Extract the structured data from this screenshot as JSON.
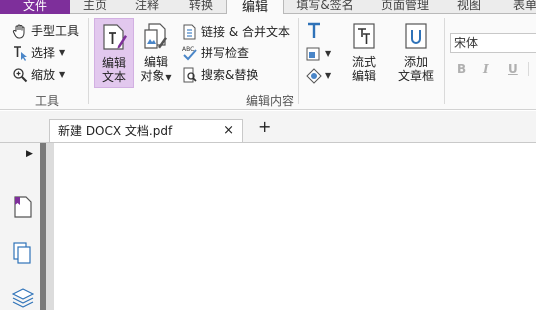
{
  "menu": {
    "tabs": [
      {
        "label": "文件"
      },
      {
        "label": "主页"
      },
      {
        "label": "注释"
      },
      {
        "label": "转换"
      },
      {
        "label": "编辑"
      },
      {
        "label": "填写&签名"
      },
      {
        "label": "页面管理"
      },
      {
        "label": "视图"
      },
      {
        "label": "表单"
      }
    ]
  },
  "ribbon": {
    "tools_group": {
      "label": "工具",
      "hand_tool": "手型工具",
      "select": "选择",
      "zoom": "缩放"
    },
    "edit_group": {
      "label": "编辑内容",
      "edit_text_line1": "编辑",
      "edit_text_line2": "文本",
      "edit_object_line1": "编辑",
      "edit_object_line2": "对象",
      "link_merge": "链接 & 合并文本",
      "spell_check": "拼写检查",
      "search_replace": "搜索&替换",
      "flow_edit_line1": "流式",
      "flow_edit_line2": "编辑",
      "add_textbox_line1": "添加",
      "add_textbox_line2": "文章框"
    },
    "font": {
      "value": "宋体",
      "bold": "B",
      "italic": "I",
      "underline": "U"
    }
  },
  "document_tab": {
    "title": "新建 DOCX 文档.pdf",
    "close": "×",
    "new_tab": "+"
  },
  "colors": {
    "accent": "#7e2f9b",
    "selected": "#e2c8ee"
  }
}
